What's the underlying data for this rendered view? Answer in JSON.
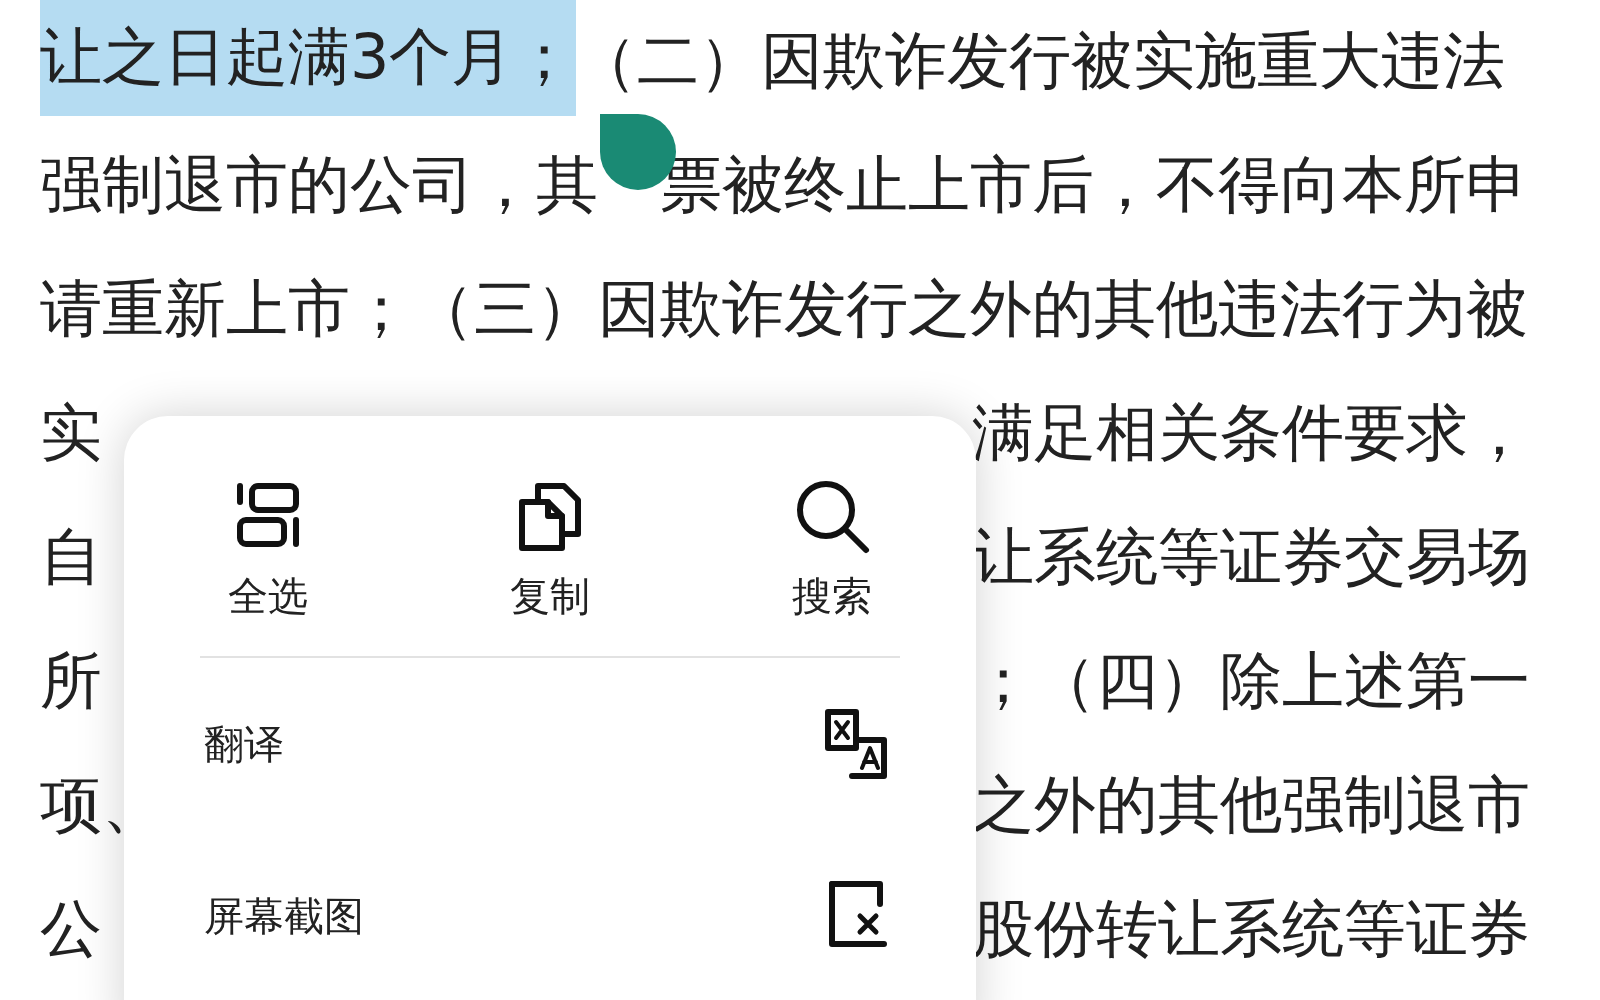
{
  "text_lines": [
    {
      "kind": "full",
      "parts": [
        {
          "text": "让之日起满3个月；",
          "selected": true
        },
        {
          "text": "（二）因欺诈发行被实施重大违法",
          "selected": false
        }
      ]
    },
    {
      "kind": "gap",
      "parts": [
        {
          "text": "强制退市的公司，其",
          "selected": false
        },
        {
          "text": "票被终止上市后，不得向本所申",
          "selected": false
        }
      ]
    },
    {
      "kind": "full",
      "parts": [
        {
          "text": "请重新上市；（三）因欺诈发行之外的其他违法行为被",
          "selected": false
        }
      ]
    },
    {
      "kind": "split",
      "parts": [
        {
          "text": "实",
          "selected": false
        },
        {
          "text": "满足相关条件要求，",
          "selected": false
        }
      ]
    },
    {
      "kind": "split",
      "parts": [
        {
          "text": "自",
          "selected": false
        },
        {
          "text": "让系统等证券交易场",
          "selected": false
        }
      ]
    },
    {
      "kind": "split",
      "parts": [
        {
          "text": "所",
          "selected": false
        },
        {
          "text": "；（四）除上述第一",
          "selected": false
        }
      ]
    },
    {
      "kind": "split",
      "parts": [
        {
          "text": "项、",
          "selected": false
        },
        {
          "text": "之外的其他强制退市",
          "selected": false
        }
      ]
    },
    {
      "kind": "split",
      "parts": [
        {
          "text": "公",
          "selected": false
        },
        {
          "text": "股份转让系统等证券",
          "selected": false
        }
      ]
    }
  ],
  "context_menu": {
    "top_actions": [
      {
        "label": "全选"
      },
      {
        "label": "复制"
      },
      {
        "label": "搜索"
      }
    ],
    "items": [
      {
        "label": "翻译"
      },
      {
        "label": "屏幕截图"
      }
    ]
  }
}
